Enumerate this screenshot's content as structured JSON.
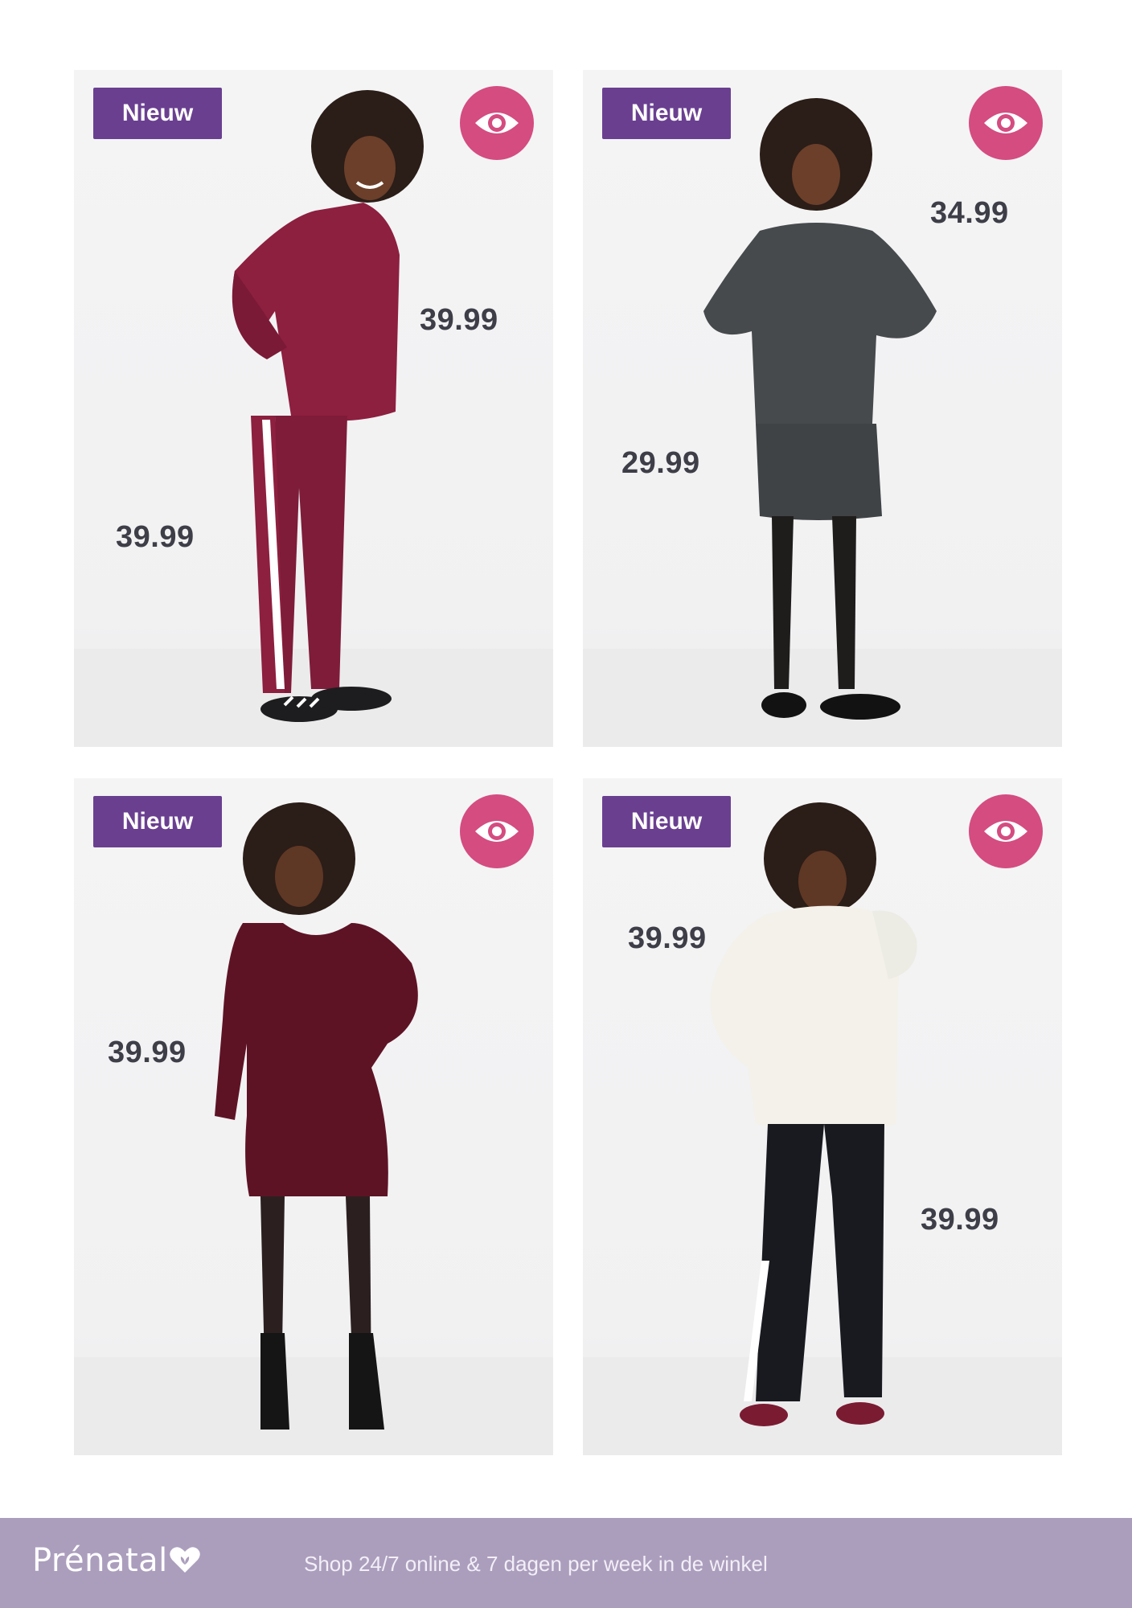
{
  "products": [
    {
      "badge": "Nieuw",
      "view_icon": "eye-icon",
      "prices": [
        "39.99",
        "39.99"
      ]
    },
    {
      "badge": "Nieuw",
      "view_icon": "eye-icon",
      "prices": [
        "34.99",
        "29.99"
      ]
    },
    {
      "badge": "Nieuw",
      "view_icon": "eye-icon",
      "prices": [
        "39.99"
      ]
    },
    {
      "badge": "Nieuw",
      "view_icon": "eye-icon",
      "prices": [
        "39.99",
        "39.99"
      ]
    }
  ],
  "footer": {
    "brand": "Prénatal",
    "brand_icon": "heart-logo-icon",
    "tagline": "Shop 24/7 online & 7 dagen per week in de winkel"
  },
  "colors": {
    "badge": "#6a3f90",
    "eye_button": "#d44c80",
    "footer": "#ab9ebd",
    "price": "#3e3e48"
  }
}
